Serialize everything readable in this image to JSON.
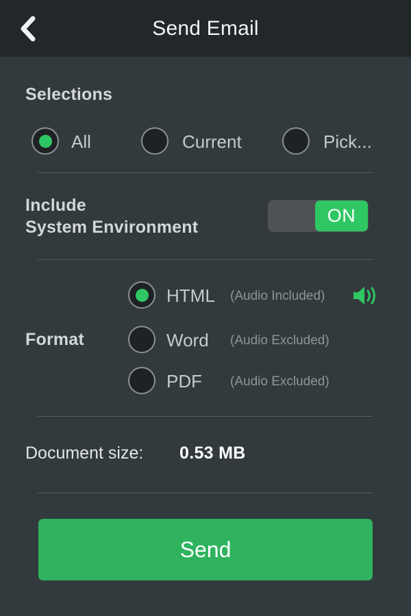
{
  "header": {
    "title": "Send Email",
    "back_icon": "chevron-left-icon"
  },
  "selections": {
    "title": "Selections",
    "options": [
      {
        "label": "All",
        "selected": true
      },
      {
        "label": "Current",
        "selected": false
      },
      {
        "label": "Pick...",
        "selected": false
      }
    ]
  },
  "include_system_environment": {
    "label_line1": "Include",
    "label_line2": "System Environment",
    "toggle_state": "ON",
    "enabled": true
  },
  "format": {
    "title": "Format",
    "options": [
      {
        "label": "HTML",
        "note": "(Audio Included)",
        "selected": true,
        "icon": "speaker-icon"
      },
      {
        "label": "Word",
        "note": "(Audio Excluded)",
        "selected": false
      },
      {
        "label": "PDF",
        "note": "(Audio Excluded)",
        "selected": false
      }
    ]
  },
  "document_size": {
    "label": "Document size:",
    "value": "0.53 MB"
  },
  "actions": {
    "send_label": "Send"
  },
  "colors": {
    "background": "#323a3d",
    "header_background": "#22272a",
    "accent_green": "#2fc763",
    "button_green": "#2fb35f",
    "text_primary": "#e2e6e8",
    "text_muted": "#8d9598",
    "separator": "#5a6265"
  }
}
